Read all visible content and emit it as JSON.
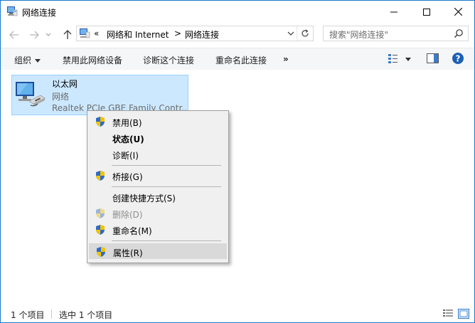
{
  "window": {
    "title": "网络连接",
    "controls": {
      "minimize_icon": "minimize-icon",
      "maximize_icon": "maximize-icon",
      "close_icon": "close-icon"
    }
  },
  "address_bar": {
    "overflow": "«",
    "segments": [
      "网络和 Internet",
      "网络连接"
    ],
    "separator": ">"
  },
  "search": {
    "placeholder": "搜索\"网络连接\""
  },
  "command_bar": {
    "organize": "组织",
    "disable_device": "禁用此网络设备",
    "diagnose": "诊断这个连接",
    "rename": "重命名此连接",
    "more": "»"
  },
  "item": {
    "name": "以太网",
    "type": "网络",
    "device": "Realtek PCIe GBE Family Contr..."
  },
  "context_menu": {
    "items": [
      {
        "label": "禁用(B)",
        "shield": true
      },
      {
        "label": "状态(U)",
        "bold": true
      },
      {
        "label": "诊断(I)"
      },
      {
        "label": "桥接(G)",
        "shield": true
      },
      {
        "label": "创建快捷方式(S)"
      },
      {
        "label": "删除(D)",
        "shield": true,
        "disabled": true
      },
      {
        "label": "重命名(M)",
        "shield": true
      },
      {
        "label": "属性(R)",
        "shield": true,
        "highlighted": true
      }
    ]
  },
  "status_bar": {
    "count": "1 个项目",
    "selected": "选中 1 个项目"
  },
  "colors": {
    "accent": "#1979ca",
    "selection": "#cce8ff",
    "help": "#1c5fb4"
  }
}
